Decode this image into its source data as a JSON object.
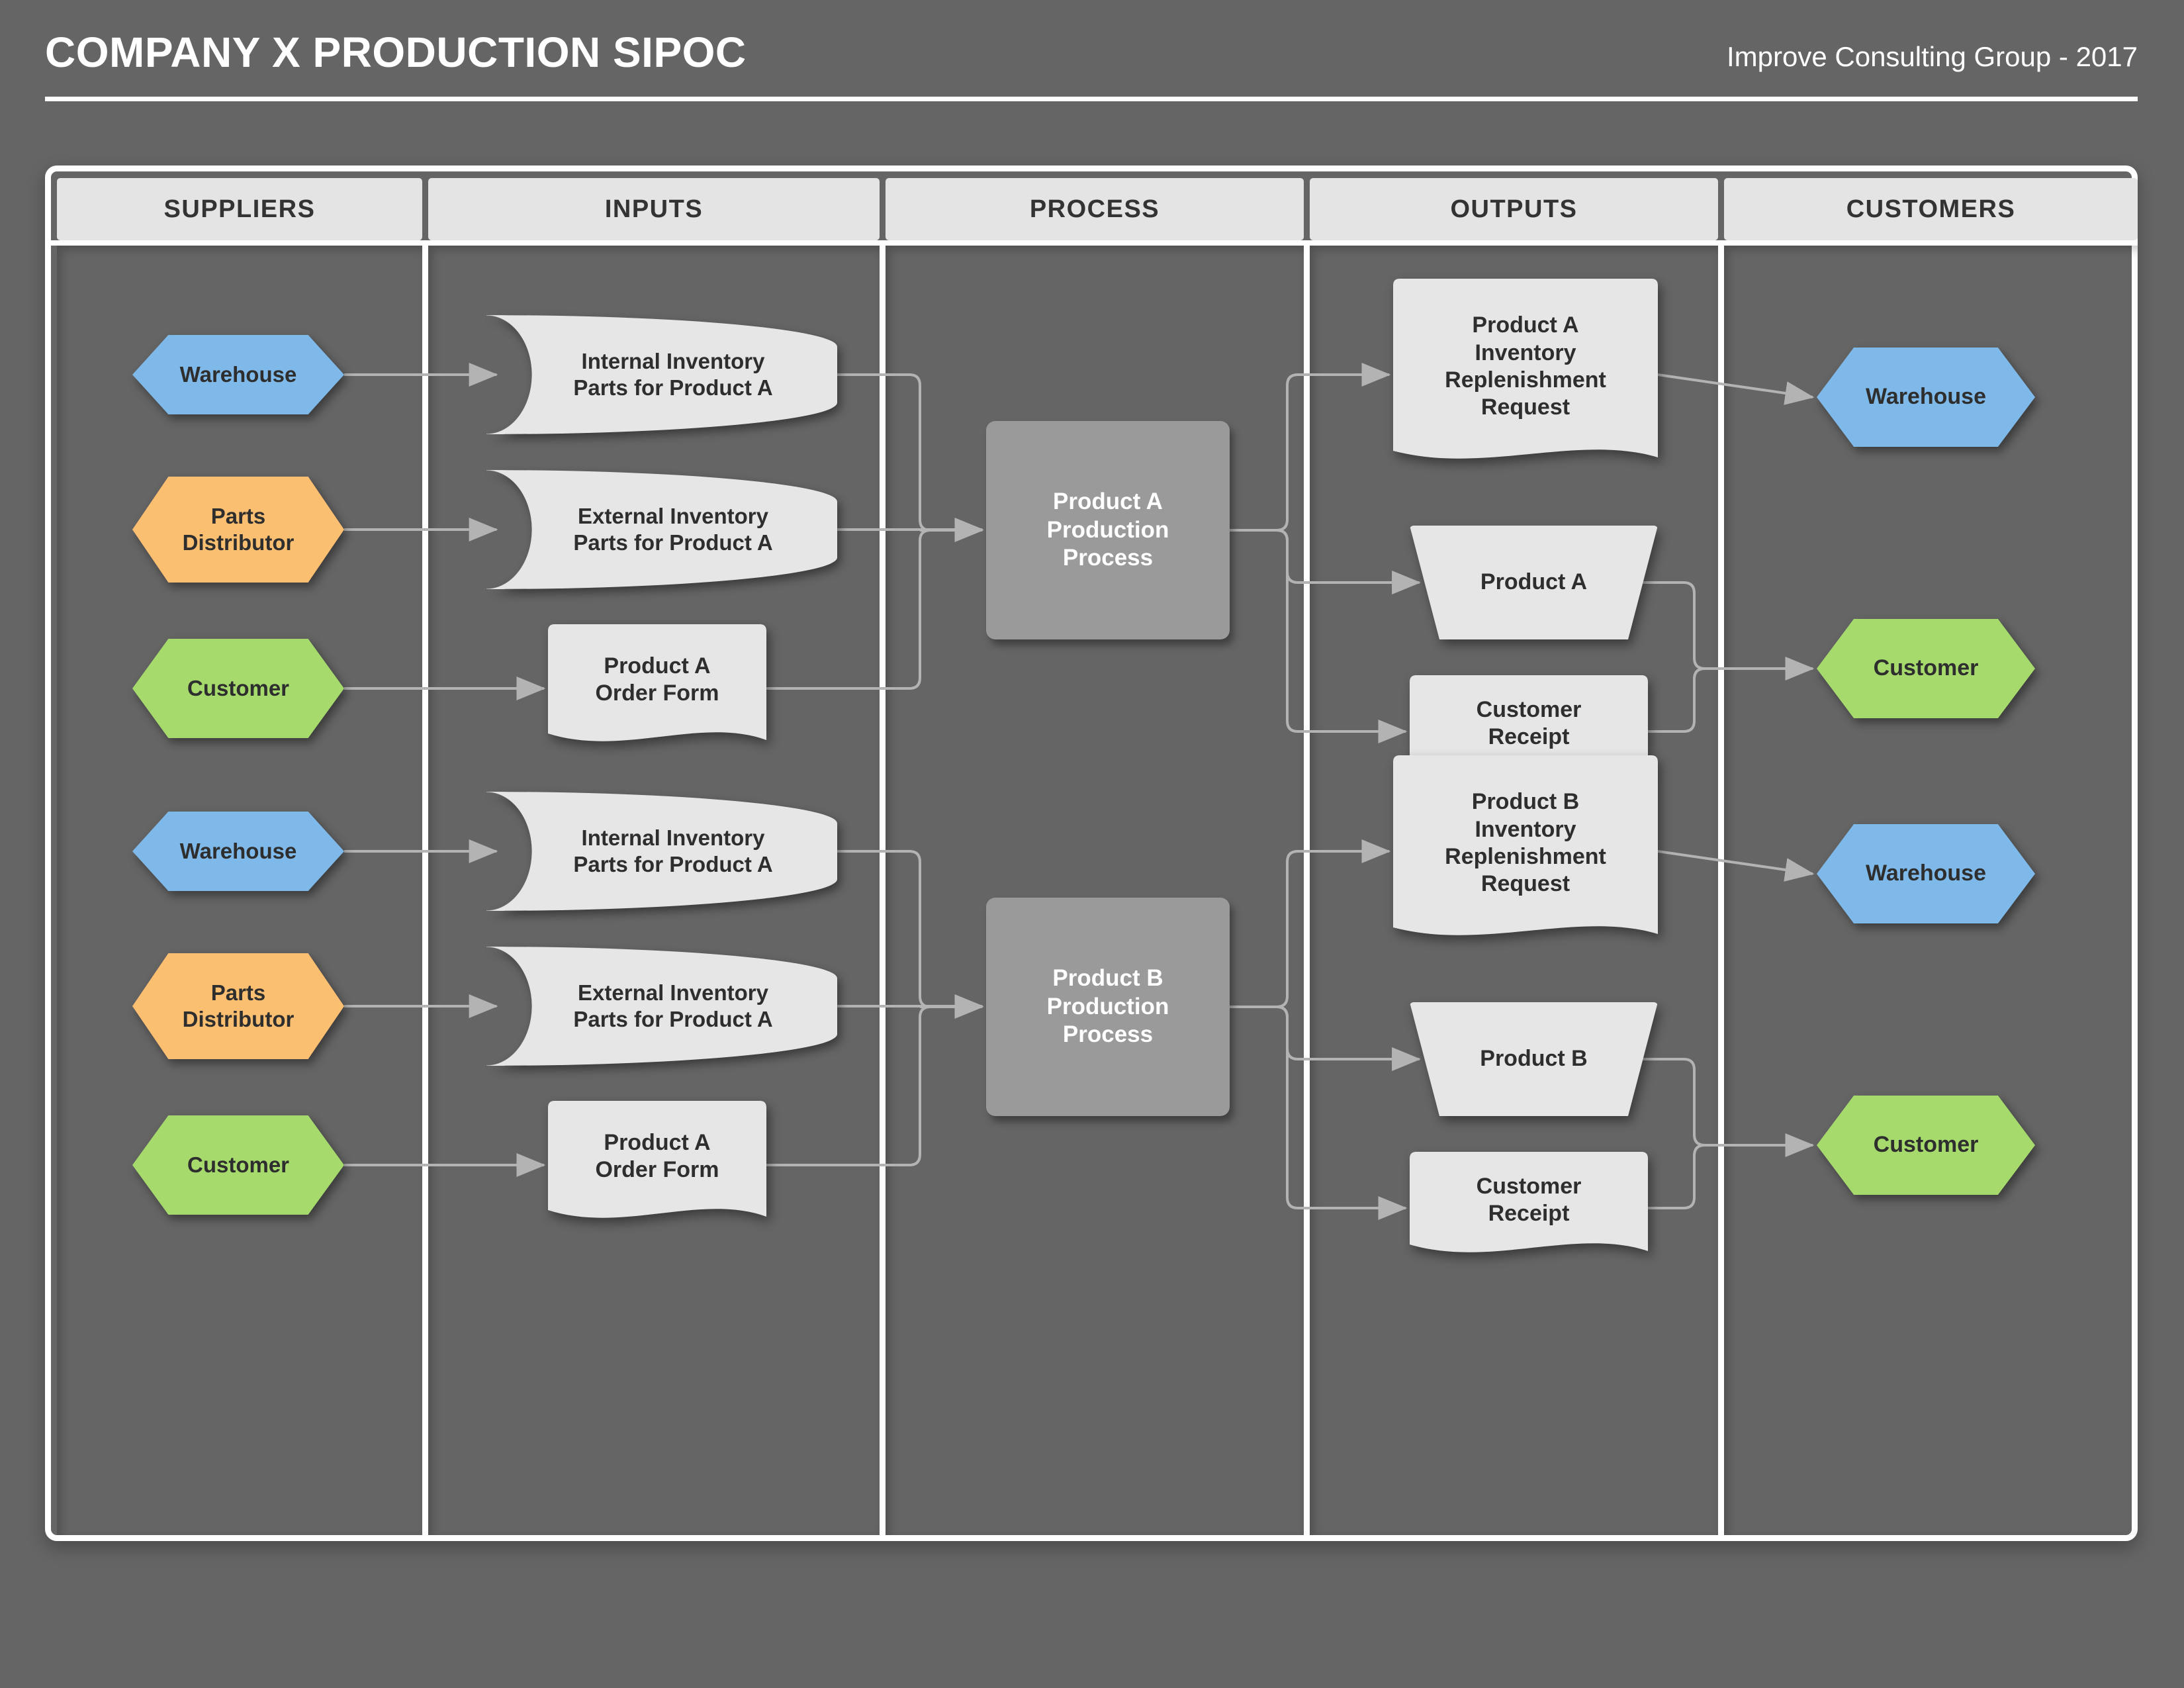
{
  "header": {
    "title": "COMPANY X PRODUCTION SIPOC",
    "credit": "Improve Consulting Group - 2017"
  },
  "colors": {
    "background": "#656565",
    "frame": "#ffffff",
    "column_header_bg": "#e4e4e4",
    "shape_fill": "#e6e6e6",
    "process_fill": "#9a9a9a",
    "supplier_warehouse": "#7fb9e9",
    "supplier_parts_distributor": "#fbbf72",
    "supplier_customer": "#a6da6d",
    "connector": "#b3b3b3",
    "text_dark": "#2e2e2e",
    "text_light": "#ffffff"
  },
  "columns": [
    {
      "key": "suppliers",
      "label": "SUPPLIERS"
    },
    {
      "key": "inputs",
      "label": "INPUTS"
    },
    {
      "key": "process",
      "label": "PROCESS"
    },
    {
      "key": "outputs",
      "label": "OUTPUTS"
    },
    {
      "key": "customers",
      "label": "CUSTOMERS"
    }
  ],
  "rows": [
    {
      "key": "product-a",
      "suppliers": [
        {
          "label": "Warehouse",
          "color": "blue"
        },
        {
          "label": "Parts\nDistributor",
          "color": "orange"
        },
        {
          "label": "Customer",
          "color": "green"
        }
      ],
      "inputs": [
        {
          "label": "Internal Inventory\nParts for Product A",
          "shape": "stored-data"
        },
        {
          "label": "External Inventory\nParts for Product A",
          "shape": "stored-data"
        },
        {
          "label": "Product A\nOrder Form",
          "shape": "document"
        }
      ],
      "process": {
        "label": "Product A\nProduction\nProcess"
      },
      "outputs": [
        {
          "label": "Product A\nInventory\nReplenishment\nRequest",
          "shape": "document"
        },
        {
          "label": "Product A",
          "shape": "trapezoid"
        },
        {
          "label": "Customer\nReceipt",
          "shape": "document"
        }
      ],
      "customers": [
        {
          "label": "Warehouse",
          "color": "blue"
        },
        {
          "label": "Customer",
          "color": "green"
        }
      ]
    },
    {
      "key": "product-b",
      "suppliers": [
        {
          "label": "Warehouse",
          "color": "blue"
        },
        {
          "label": "Parts\nDistributor",
          "color": "orange"
        },
        {
          "label": "Customer",
          "color": "green"
        }
      ],
      "inputs": [
        {
          "label": "Internal Inventory\nParts for Product A",
          "shape": "stored-data"
        },
        {
          "label": "External Inventory\nParts for Product A",
          "shape": "stored-data"
        },
        {
          "label": "Product A\nOrder Form",
          "shape": "document"
        }
      ],
      "process": {
        "label": "Product B\nProduction\nProcess"
      },
      "outputs": [
        {
          "label": "Product B\nInventory\nReplenishment\nRequest",
          "shape": "document"
        },
        {
          "label": "Product B",
          "shape": "trapezoid"
        },
        {
          "label": "Customer\nReceipt",
          "shape": "document"
        }
      ],
      "customers": [
        {
          "label": "Warehouse",
          "color": "blue"
        },
        {
          "label": "Customer",
          "color": "green"
        }
      ]
    }
  ]
}
